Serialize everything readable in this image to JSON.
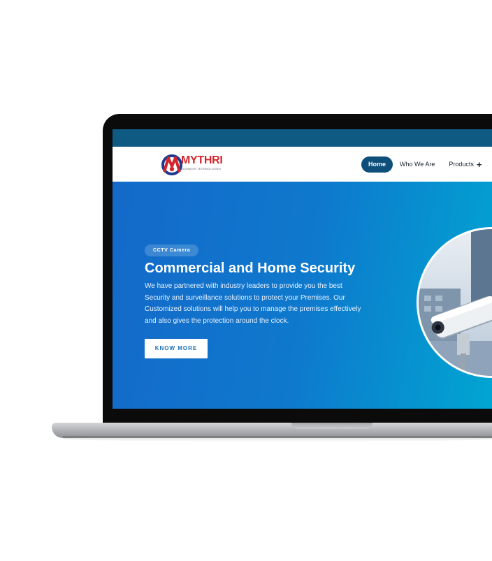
{
  "brand": {
    "name": "MYTHRI",
    "tagline": "BUSINESS TECHNOLOGIES",
    "colors": {
      "red": "#d3262b",
      "navy": "#1f3a8f"
    }
  },
  "nav": {
    "items": [
      {
        "label": "Home",
        "active": true
      },
      {
        "label": "Who We Are",
        "active": false
      },
      {
        "label": "Products",
        "active": false,
        "icon": "plus-icon"
      }
    ]
  },
  "hero": {
    "badge": "CCTV Camera",
    "title": "Commercial and Home Security",
    "description": "We have partnered with industry leaders to provide you the best Security and surveillance solutions to protect your Premises. Our Customized solutions will help you to manage the premises effectively and also gives the protection around the clock.",
    "cta_label": "KNOW MORE",
    "image": "cctv-camera-photo"
  },
  "colors": {
    "topbar": "#0e5a82",
    "nav_active": "#0e4e7a",
    "hero_gradient_start": "#1469c9",
    "hero_gradient_end": "#00a8d2",
    "cta_text": "#1a6fb0"
  }
}
